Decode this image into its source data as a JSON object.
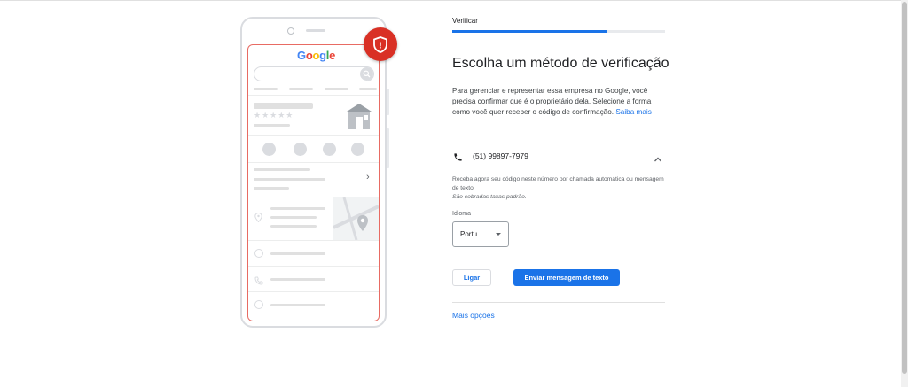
{
  "illustration": {
    "brand": [
      "G",
      "o",
      "o",
      "g",
      "l",
      "e"
    ],
    "brand_colors": [
      "#4285f4",
      "#ea4335",
      "#fbbc05",
      "#4285f4",
      "#34a853",
      "#ea4335"
    ],
    "rating_stars": "★★★★★",
    "chevron": "›",
    "shield_mark": "!"
  },
  "verify": {
    "step_label": "Verificar",
    "progress_fraction": 0.73,
    "title": "Escolha um método de verificação",
    "description": "Para gerenciar e representar essa empresa no Google, você precisa confirmar que é o proprietário dela. Selecione a forma como você quer receber o código de confirmação.",
    "learn_more": "Saiba mais",
    "phone_number": "(51) 99897-7979",
    "info_line": "Receba agora seu código neste número por chamada automática ou mensagem de texto.",
    "info_note": "São cobradas taxas padrão.",
    "language_label": "Idioma",
    "language_value": "Portu...",
    "call_button": "Ligar",
    "text_button": "Enviar mensagem de texto",
    "more_options": "Mais opções"
  },
  "colors": {
    "accent": "#1a73e8",
    "alert": "#d93025"
  }
}
